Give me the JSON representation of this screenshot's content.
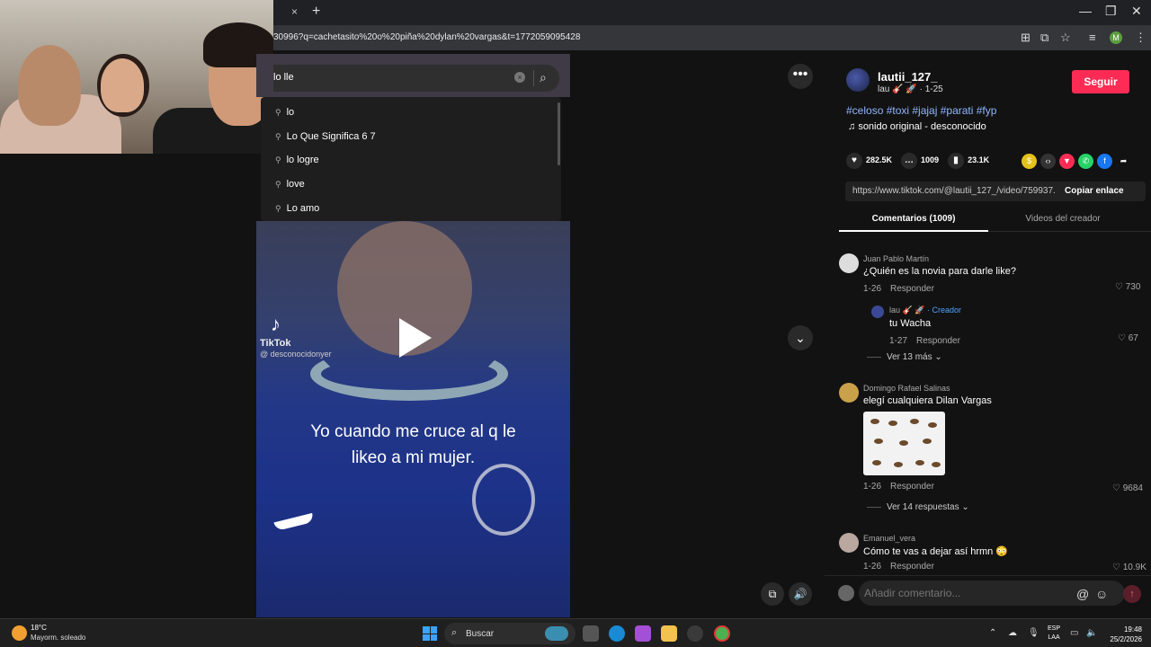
{
  "browser": {
    "tab_close": "×",
    "new_tab": "+",
    "url": "30996?q=cachetasito%20o%20piña%20dylan%20vargas&t=1772059095428",
    "profile_initial": "M"
  },
  "search": {
    "query": "lo lle",
    "suggestions": [
      "lo",
      "Lo Que Significa 6 7",
      "lo logre",
      "love",
      "Lo amo"
    ]
  },
  "video": {
    "watermark": "TikTok",
    "watermark_user": "@ desconocidonyer",
    "caption_line1": "Yo cuando me cruce al q le",
    "caption_line2": "likeo a mi mujer."
  },
  "author": {
    "username": "lautii_127_",
    "sub": "lau 🎸 🚀 · 1-25",
    "follow_label": "Seguir",
    "hashtags": "#celoso #toxi #jajaj #parati #fyp",
    "music": "sonido original - desconocido"
  },
  "stats": {
    "likes": "282.5K",
    "comments": "1009",
    "saves": "23.1K"
  },
  "link": {
    "url": "https://www.tiktok.com/@lautii_127_/video/759937...",
    "copy_label": "Copiar enlace"
  },
  "tabs": {
    "comments": "Comentarios (1009)",
    "creator_videos": "Videos del creador"
  },
  "comments": [
    {
      "name": "Juan Pablo Martín",
      "text": "¿Quién es la novia para darle like?",
      "date": "1-26",
      "reply": "Responder",
      "likes": "730"
    },
    {
      "name": "lau 🎸 🚀",
      "creator_tag": "· Creador",
      "text": "tu Wacha",
      "date": "1-27",
      "reply": "Responder",
      "likes": "67"
    },
    {
      "name": "Domingo Rafael Salinas",
      "text": "elegí cualquiera Dilan Vargas",
      "date": "1-26",
      "reply": "Responder",
      "likes": "9684"
    },
    {
      "name": "Emanuel_vera",
      "text": "Cómo te vas a dejar así hrmn 😳",
      "date": "1-26",
      "reply": "Responder",
      "likes": "10.9K"
    }
  ],
  "more_replies": [
    "Ver 13 más",
    "Ver 14 respuestas"
  ],
  "comment_input": {
    "placeholder": "Añadir comentario..."
  },
  "taskbar": {
    "temp": "18°C",
    "weather": "Mayorm. soleado",
    "search": "Buscar",
    "lang1": "ESP",
    "lang2": "LAA",
    "time": "19:48",
    "date": "25/2/2026"
  }
}
